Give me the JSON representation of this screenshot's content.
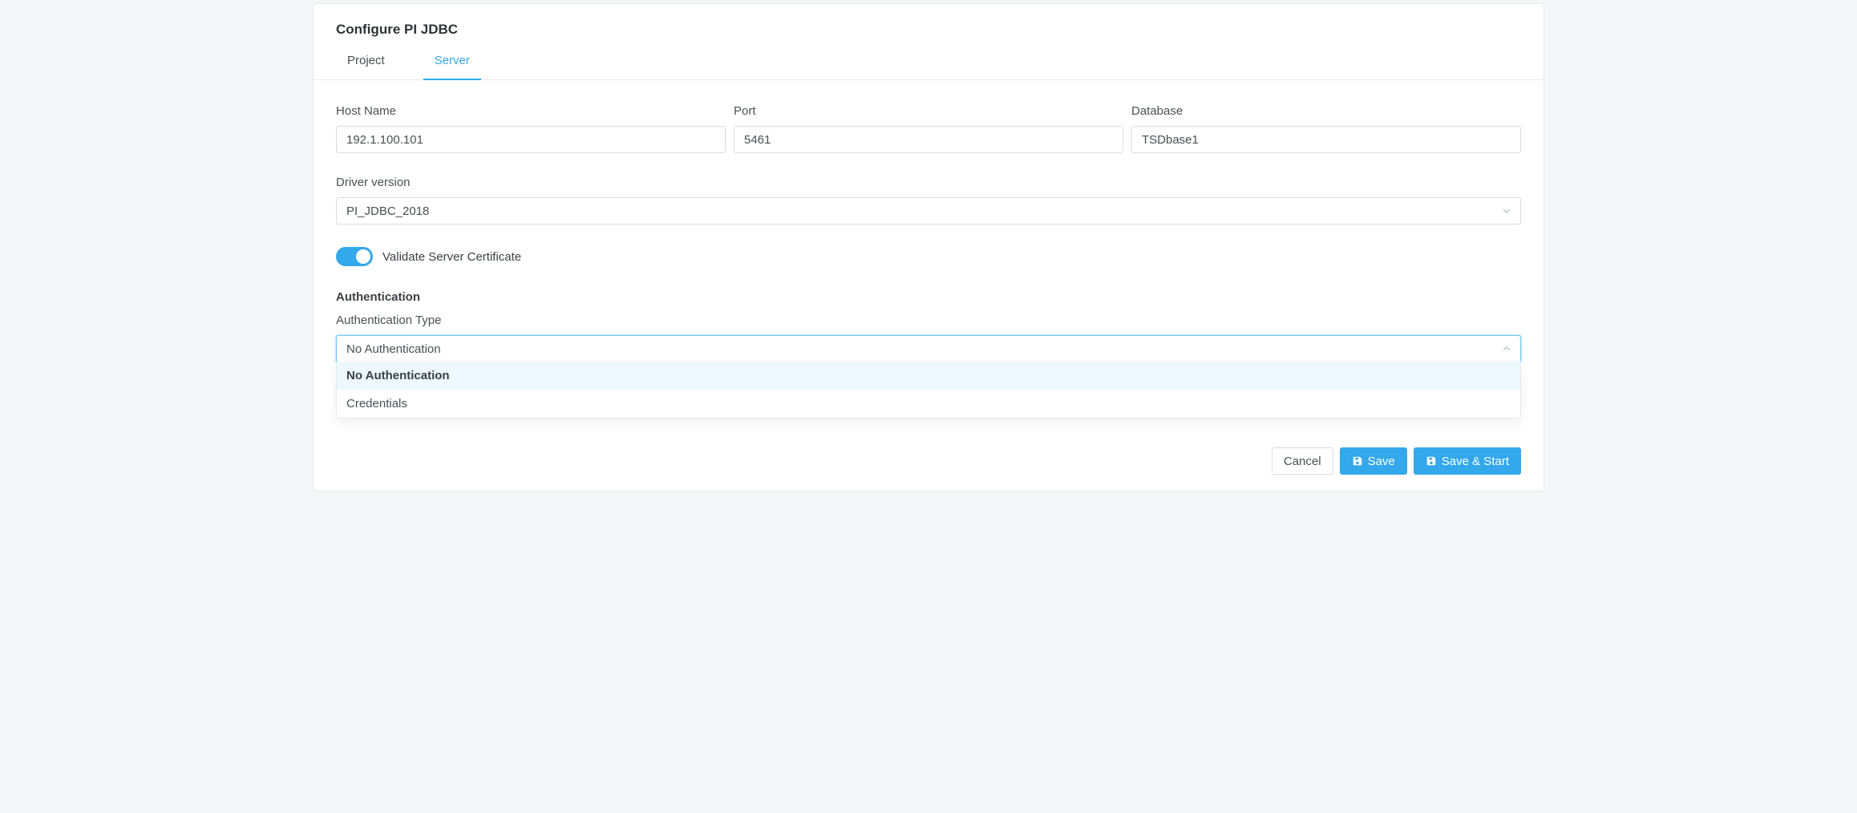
{
  "header": {
    "title": "Configure PI JDBC"
  },
  "tabs": {
    "project": "Project",
    "server": "Server",
    "active": "server"
  },
  "form": {
    "host": {
      "label": "Host Name",
      "value": "192.1.100.101"
    },
    "port": {
      "label": "Port",
      "value": "5461"
    },
    "database": {
      "label": "Database",
      "value": "TSDbase1"
    },
    "driver": {
      "label": "Driver version",
      "value": "PI_JDBC_2018"
    },
    "validateCert": {
      "label": "Validate Server Certificate",
      "enabled": true
    }
  },
  "auth": {
    "section": "Authentication",
    "typeLabel": "Authentication Type",
    "selected": "No Authentication",
    "options": [
      "No Authentication",
      "Credentials"
    ]
  },
  "footer": {
    "cancel": "Cancel",
    "save": "Save",
    "saveStart": "Save & Start"
  }
}
